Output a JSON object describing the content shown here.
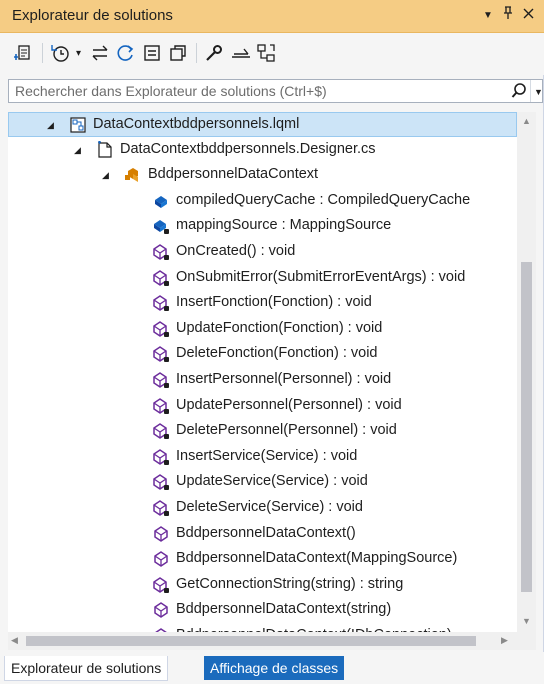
{
  "titlebar": {
    "title": "Explorateur de solutions",
    "controls": [
      "dropdown-icon",
      "pin-icon",
      "close-icon"
    ]
  },
  "toolbar": {
    "buttons": [
      "sync-icon",
      "history-icon",
      "dropdown-arrow-icon",
      "switch-views-icon",
      "refresh-icon",
      "collapse-all-icon",
      "show-all-files-icon",
      "properties-icon",
      "preview-icon",
      "class-diagram-icon"
    ]
  },
  "search": {
    "placeholder": "Rechercher dans Explorateur de solutions (Ctrl+$)"
  },
  "tree": {
    "rows": [
      {
        "label": "DataContextbddpersonnels.lqml",
        "icon": "dbml-file-icon",
        "level": 0,
        "expanded": true,
        "selected": true
      },
      {
        "label": "DataContextbddpersonnels.Designer.cs",
        "icon": "cs-file-icon",
        "level": 1,
        "expanded": true
      },
      {
        "label": "BddpersonnelDataContext",
        "icon": "class-icon",
        "level": 2,
        "expanded": true
      },
      {
        "label": "compiledQueryCache : CompiledQueryCache",
        "icon": "field-icon",
        "level": 3
      },
      {
        "label": "mappingSource : MappingSource",
        "icon": "private-field-icon",
        "level": 3
      },
      {
        "label": "OnCreated() : void",
        "icon": "private-method-icon",
        "level": 3
      },
      {
        "label": "OnSubmitError(SubmitErrorEventArgs) : void",
        "icon": "private-method-icon",
        "level": 3
      },
      {
        "label": "InsertFonction(Fonction) : void",
        "icon": "private-method-icon",
        "level": 3
      },
      {
        "label": "UpdateFonction(Fonction) : void",
        "icon": "private-method-icon",
        "level": 3
      },
      {
        "label": "DeleteFonction(Fonction) : void",
        "icon": "private-method-icon",
        "level": 3
      },
      {
        "label": "InsertPersonnel(Personnel) : void",
        "icon": "private-method-icon",
        "level": 3
      },
      {
        "label": "UpdatePersonnel(Personnel) : void",
        "icon": "private-method-icon",
        "level": 3
      },
      {
        "label": "DeletePersonnel(Personnel) : void",
        "icon": "private-method-icon",
        "level": 3
      },
      {
        "label": "InsertService(Service) : void",
        "icon": "private-method-icon",
        "level": 3
      },
      {
        "label": "UpdateService(Service) : void",
        "icon": "private-method-icon",
        "level": 3
      },
      {
        "label": "DeleteService(Service) : void",
        "icon": "private-method-icon",
        "level": 3
      },
      {
        "label": "BddpersonnelDataContext()",
        "icon": "method-icon",
        "level": 3
      },
      {
        "label": "BddpersonnelDataContext(MappingSource)",
        "icon": "method-icon",
        "level": 3
      },
      {
        "label": "GetConnectionString(string) : string",
        "icon": "private-method-icon",
        "level": 3
      },
      {
        "label": "BddpersonnelDataContext(string)",
        "icon": "method-icon",
        "level": 3
      },
      {
        "label": "BddpersonnelDataContext(IDbConnection)",
        "icon": "method-icon",
        "level": 3
      }
    ]
  },
  "tabs": {
    "solution_label": "Explorateur de solutions",
    "classes_label": "Affichage de classes"
  },
  "colors": {
    "titlebar": "#f5cc84",
    "selection": "#cce4f7",
    "active_tab": "#1b6bbd",
    "method_purple": "#6c2d9c",
    "field_blue": "#1565c0",
    "class_orange": "#d67f00"
  }
}
